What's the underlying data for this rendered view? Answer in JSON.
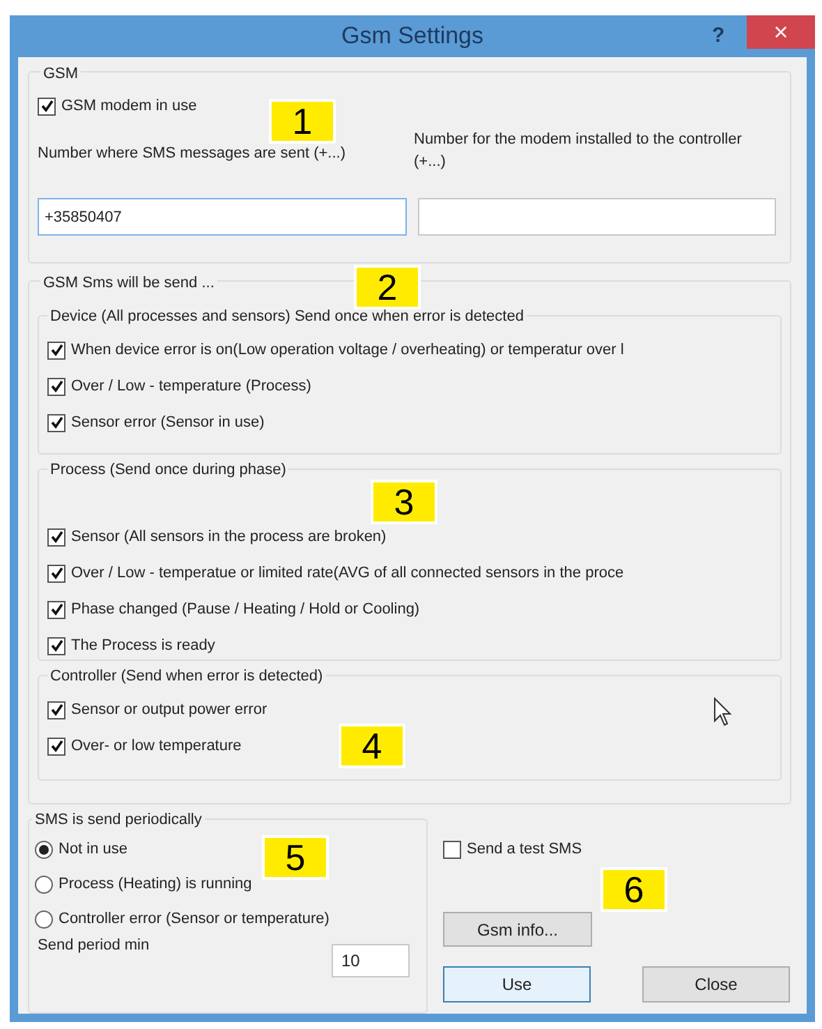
{
  "window": {
    "title": "Gsm Settings",
    "help": "?",
    "close": "×"
  },
  "gsm": {
    "title": "GSM",
    "modem_in_use": {
      "label": "GSM modem in use",
      "checked": true
    },
    "sms_number": {
      "label": "Number where SMS messages are sent (+...)",
      "value": "+35850407"
    },
    "modem_number": {
      "label": "Number for the modem installed to the controller (+...)"
    }
  },
  "send_group": {
    "title": "GSM Sms will be send ...",
    "sections": [
      {
        "title": "Device (All processes and sensors) Send once when error is detected",
        "items": [
          {
            "label": "When device error is on(Low operation voltage / overheating) or temperatur over l",
            "checked": true
          },
          {
            "label": "Over / Low - temperature (Process)",
            "checked": true
          },
          {
            "label": "Sensor error (Sensor in use)",
            "checked": true
          }
        ]
      },
      {
        "title": "Process (Send once during phase)",
        "items": [
          {
            "label": "Sensor (All sensors in the process are broken)",
            "checked": true
          },
          {
            "label": "Over / Low - temperatue or limited rate(AVG of all connected sensors in the proce",
            "checked": true
          },
          {
            "label": "Phase changed (Pause / Heating / Hold or Cooling)",
            "checked": true
          },
          {
            "label": "The Process is ready",
            "checked": true
          }
        ]
      },
      {
        "title": "Controller (Send when error is detected)",
        "items": [
          {
            "label": "Sensor or output power error",
            "checked": true
          },
          {
            "label": "Over- or low temperature",
            "checked": true
          }
        ]
      }
    ]
  },
  "periodic": {
    "title": "SMS is send periodically",
    "options": [
      {
        "label": "Not in use",
        "selected": true
      },
      {
        "label": "Process (Heating) is running",
        "selected": false
      },
      {
        "label": "Controller error (Sensor or temperature)",
        "selected": false
      }
    ],
    "period": {
      "label": "Send period min",
      "value": "10"
    }
  },
  "test_sms": {
    "label": "Send a test SMS",
    "checked": false
  },
  "info_button": {
    "label": "Gsm info..."
  },
  "buttons": [
    {
      "label": "Use",
      "default": true
    },
    {
      "label": "Close",
      "default": false
    }
  ],
  "annotations": [
    {
      "label": "1"
    },
    {
      "label": "2"
    },
    {
      "label": "3"
    },
    {
      "label": "4"
    },
    {
      "label": "5"
    },
    {
      "label": "6"
    }
  ]
}
